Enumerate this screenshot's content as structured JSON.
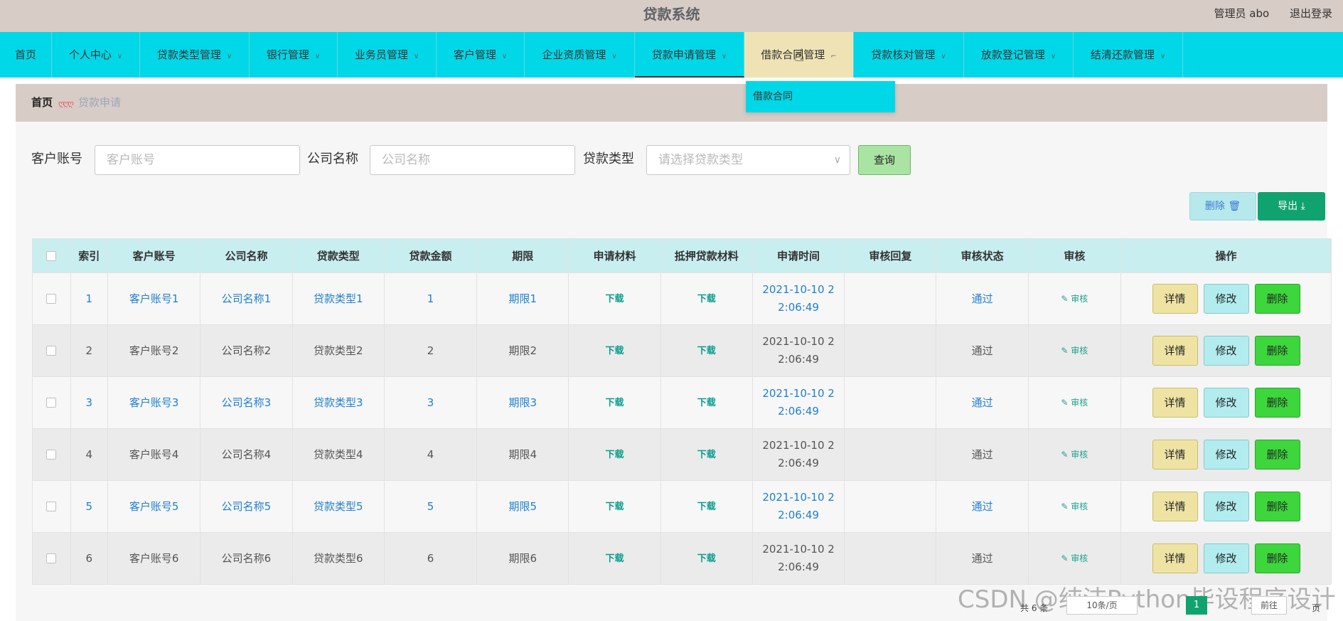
{
  "header": {
    "title": "贷款系统",
    "admin_label": "管理员 abo",
    "logout_label": "退出登录"
  },
  "nav": {
    "items": [
      {
        "label": "首页"
      },
      {
        "label": "个人中心"
      },
      {
        "label": "贷款类型管理"
      },
      {
        "label": "银行管理"
      },
      {
        "label": "业务员管理"
      },
      {
        "label": "客户管理"
      },
      {
        "label": "企业资质管理"
      },
      {
        "label": "贷款申请管理"
      },
      {
        "label": "借款合同管理"
      },
      {
        "label": "贷款核对管理"
      },
      {
        "label": "放款登记管理"
      },
      {
        "label": "结清还款管理"
      }
    ],
    "dropdown_item": "借款合同"
  },
  "breadcrumb": {
    "home": "首页",
    "current": "贷款申请"
  },
  "filters": {
    "account_label": "客户账号",
    "account_placeholder": "客户账号",
    "company_label": "公司名称",
    "company_placeholder": "公司名称",
    "type_label": "贷款类型",
    "type_placeholder": "请选择贷款类型",
    "query_label": "查询"
  },
  "actions": {
    "delete_label": "删除",
    "export_label": "导出"
  },
  "table": {
    "headers": [
      "索引",
      "客户账号",
      "公司名称",
      "贷款类型",
      "贷款金额",
      "期限",
      "申请材料",
      "抵押贷款材料",
      "申请时间",
      "审核回复",
      "审核状态",
      "审核",
      "操作"
    ],
    "download_label": "下载",
    "audit_label": "审核",
    "detail_label": "详情",
    "edit_label": "修改",
    "row_delete_label": "删除",
    "rows": [
      {
        "index": "1",
        "account": "客户账号1",
        "company": "公司名称1",
        "type": "贷款类型1",
        "amount": "1",
        "term": "期限1",
        "time_a": "2021-10-10 2",
        "time_b": "2:06:49",
        "reply": "",
        "status": "通过"
      },
      {
        "index": "2",
        "account": "客户账号2",
        "company": "公司名称2",
        "type": "贷款类型2",
        "amount": "2",
        "term": "期限2",
        "time_a": "2021-10-10 2",
        "time_b": "2:06:49",
        "reply": "",
        "status": "通过"
      },
      {
        "index": "3",
        "account": "客户账号3",
        "company": "公司名称3",
        "type": "贷款类型3",
        "amount": "3",
        "term": "期限3",
        "time_a": "2021-10-10 2",
        "time_b": "2:06:49",
        "reply": "",
        "status": "通过"
      },
      {
        "index": "4",
        "account": "客户账号4",
        "company": "公司名称4",
        "type": "贷款类型4",
        "amount": "4",
        "term": "期限4",
        "time_a": "2021-10-10 2",
        "time_b": "2:06:49",
        "reply": "",
        "status": "通过"
      },
      {
        "index": "5",
        "account": "客户账号5",
        "company": "公司名称5",
        "type": "贷款类型5",
        "amount": "5",
        "term": "期限5",
        "time_a": "2021-10-10 2",
        "time_b": "2:06:49",
        "reply": "",
        "status": "通过"
      },
      {
        "index": "6",
        "account": "客户账号6",
        "company": "公司名称6",
        "type": "贷款类型6",
        "amount": "6",
        "term": "期限6",
        "time_a": "2021-10-10 2",
        "time_b": "2:06:49",
        "reply": "",
        "status": "通过"
      }
    ]
  },
  "pagination": {
    "total_label": "共 6 条",
    "page_size_label": "10条/页",
    "current_page": "1",
    "prev_label": "前往",
    "suffix_label": "页"
  },
  "watermark": "CSDN @纯洁Python毕设程序设计",
  "colors": {
    "nav_bg": "#00d8e8",
    "top_bg": "#d8ccc7",
    "link": "#1f7fd1",
    "accent_green": "#10a36f"
  }
}
